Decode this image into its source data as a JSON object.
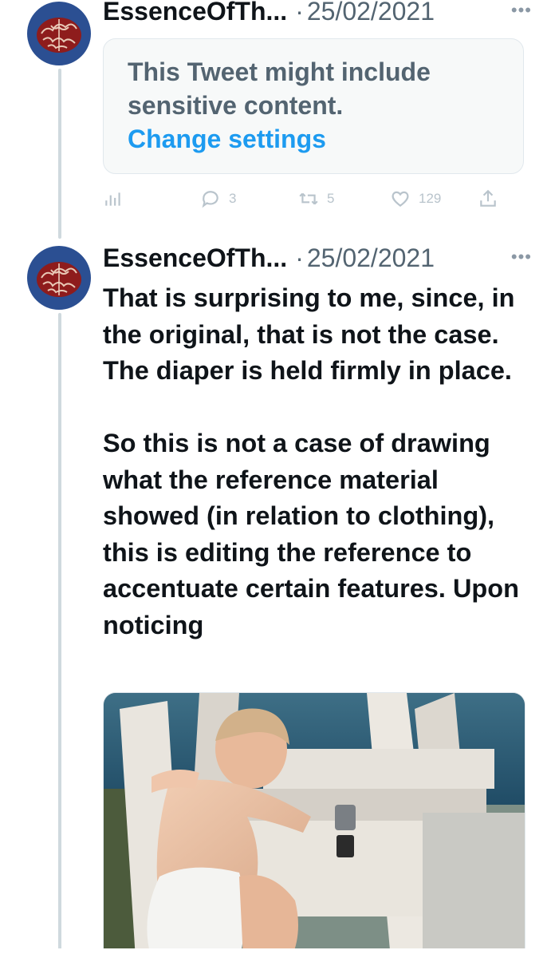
{
  "tweets": [
    {
      "author": "EssenceOfTh...",
      "separator": "·",
      "date": "25/02/2021",
      "more_icon": "more-horizontal-icon",
      "sensitive_notice": {
        "message": "This Tweet might include sensitive content.",
        "link": "Change settings"
      },
      "actions": {
        "analytics_icon": "analytics-icon",
        "replies": "3",
        "retweets": "5",
        "likes": "129",
        "share_icon": "share-icon"
      }
    },
    {
      "author": "EssenceOfTh...",
      "separator": "·",
      "date": "25/02/2021",
      "more_icon": "more-horizontal-icon",
      "text": "That is surprising to me, since, in the original, that is not the case. The diaper is held firmly in place.\n\nSo this is not a case of drawing what the reference material showed (in relation to clothing), this is editing the reference to accentuate certain features. Upon noticing",
      "media": "photo-attachment"
    }
  ],
  "colors": {
    "link": "#1d9bf0",
    "secondary_text": "#536471",
    "avatar_bg": "#2b4f92",
    "thread_line": "#cfd9de"
  }
}
